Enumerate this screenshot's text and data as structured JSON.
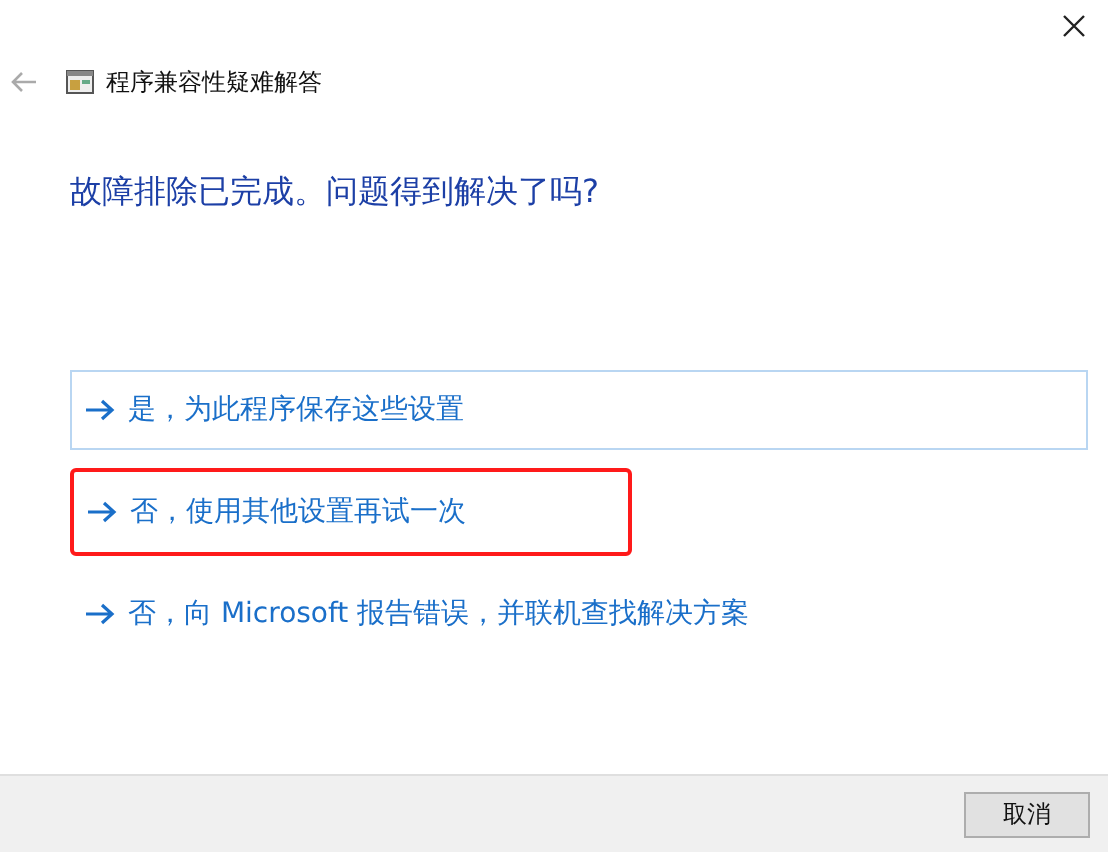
{
  "window": {
    "title": "程序兼容性疑难解答"
  },
  "heading": "故障排除已完成。问题得到解决了吗?",
  "options": [
    {
      "label": "是，为此程序保存这些设置",
      "focused": true,
      "highlighted": false
    },
    {
      "label": "否，使用其他设置再试一次",
      "focused": false,
      "highlighted": true
    },
    {
      "label": "否，向 Microsoft 报告错误，并联机查找解决方案",
      "focused": false,
      "highlighted": false
    }
  ],
  "buttons": [
    "取消"
  ]
}
